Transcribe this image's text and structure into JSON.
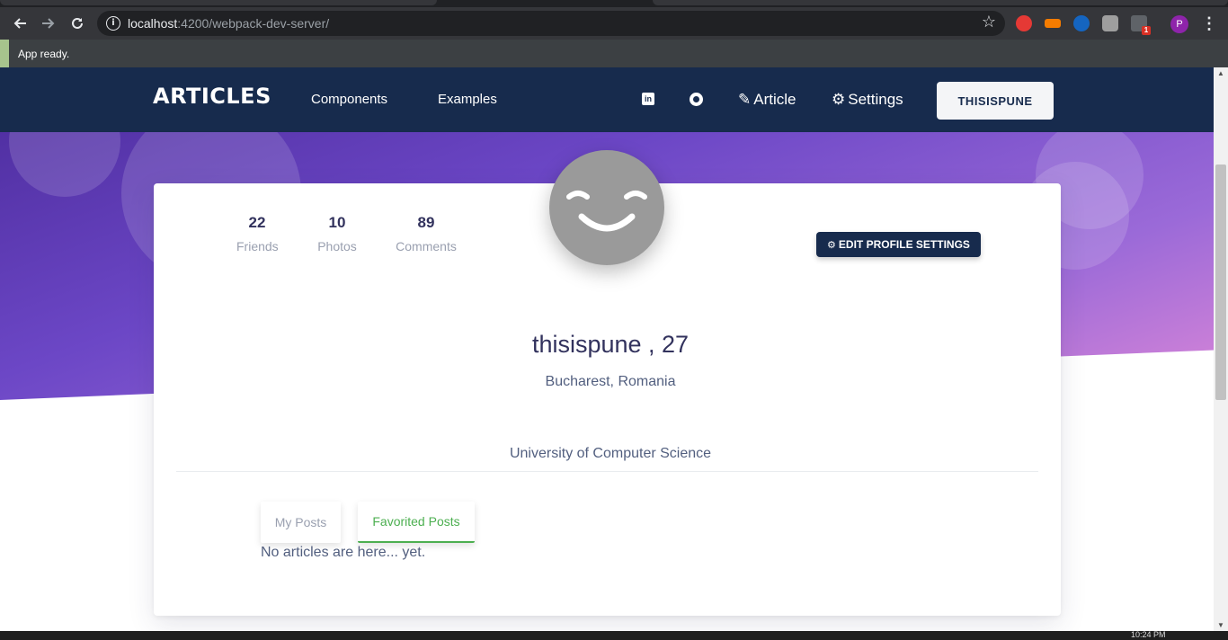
{
  "browser": {
    "url_host": "localhost",
    "url_rest": ":4200/webpack-dev-server/",
    "extension_badge": "1",
    "profile_initial": "P"
  },
  "status": {
    "text": "App ready."
  },
  "navbar": {
    "brand": "ARTICLES",
    "links": [
      "Components",
      "Examples"
    ],
    "article_label": "Article",
    "settings_label": "Settings",
    "user_button": "THISISPUNE"
  },
  "profile": {
    "stats": [
      {
        "value": "22",
        "label": "Friends"
      },
      {
        "value": "10",
        "label": "Photos"
      },
      {
        "value": "89",
        "label": "Comments"
      }
    ],
    "edit_button": "EDIT PROFILE SETTINGS",
    "name": "thisispune , 27",
    "location": "Bucharest, Romania",
    "university": "University of Computer Science",
    "tabs": [
      {
        "label": "My Posts",
        "active": false
      },
      {
        "label": "Favorited Posts",
        "active": true
      }
    ],
    "empty_message": "No articles are here... yet."
  },
  "taskbar": {
    "clock": "10:24 PM"
  },
  "colors": {
    "navbar": "#172b4d",
    "active_tab": "#4caf50",
    "avatar": "#9a9a9a"
  }
}
